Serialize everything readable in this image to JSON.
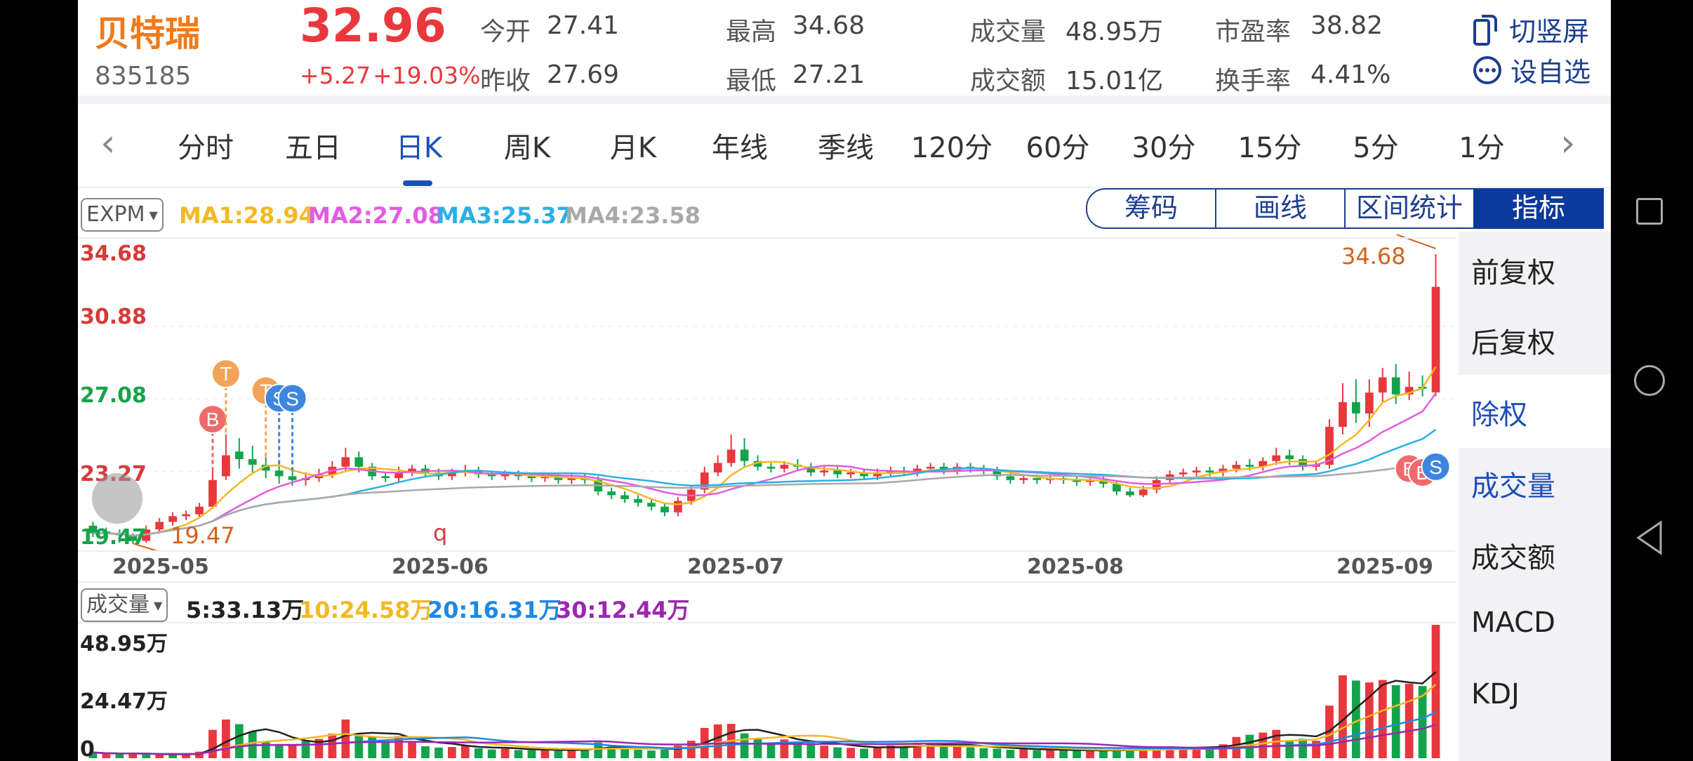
{
  "stock": {
    "name": "贝特瑞",
    "code": "835185",
    "price": "32.96",
    "change": "+5.27",
    "change_pct": "+19.03%"
  },
  "quote": [
    {
      "label": "今开",
      "value": "27.41"
    },
    {
      "label": "昨收",
      "value": "27.69"
    },
    {
      "label": "最高",
      "value": "34.68"
    },
    {
      "label": "最低",
      "value": "27.21"
    },
    {
      "label": "成交量",
      "value": "48.95万"
    },
    {
      "label": "成交额",
      "value": "15.01亿"
    },
    {
      "label": "市盈率",
      "value": "38.82"
    },
    {
      "label": "换手率",
      "value": "4.41%"
    }
  ],
  "actions": {
    "rotate_label": "切竖屏",
    "watchlist_label": "设自选"
  },
  "period_tabs": [
    "分时",
    "五日",
    "日K",
    "周K",
    "月K",
    "年线",
    "季线",
    "120分",
    "60分",
    "30分",
    "15分",
    "5分",
    "1分"
  ],
  "active_tab": "日K",
  "nav": {
    "prev": "‹",
    "next": "›"
  },
  "indicator_select": "EXPM",
  "ma_legend": [
    {
      "text": "MA1:28.94",
      "color": "#f3b924"
    },
    {
      "text": "MA2:27.08",
      "color": "#e25ce0"
    },
    {
      "text": "MA3:25.37",
      "color": "#2ab0e6"
    },
    {
      "text": "MA4:23.58",
      "color": "#a9a9a9"
    }
  ],
  "tool_buttons": [
    "筹码",
    "画线",
    "区间统计",
    "指标"
  ],
  "side_menu": [
    "前复权",
    "后复权",
    "除权",
    "成交量",
    "成交额",
    "MACD",
    "KDJ"
  ],
  "price_axis": {
    "labels": [
      "34.68",
      "30.88",
      "27.08",
      "23.27",
      "19.47"
    ],
    "label_colors": [
      "#d83a3a",
      "#d83a3a",
      "#17a34a",
      "#d83a3a",
      "#17a34a"
    ],
    "max_marker": "34.68",
    "min_marker": "19.47",
    "misc_marker": "q"
  },
  "date_axis": [
    "2025-05",
    "2025-06",
    "2025-07",
    "2025-08",
    "2025-09"
  ],
  "trade_markers": [
    {
      "text": "B",
      "color": "#ee6b6b"
    },
    {
      "text": "T",
      "color": "#f2a35a"
    },
    {
      "text": "T",
      "color": "#f2a35a"
    },
    {
      "text": "S",
      "color": "#3d86e0"
    },
    {
      "text": "S",
      "color": "#3d86e0"
    },
    {
      "text": "B",
      "color": "#ee6b6b"
    },
    {
      "text": "B",
      "color": "#ee6b6b"
    },
    {
      "text": "S",
      "color": "#3d86e0"
    }
  ],
  "volume": {
    "select": "成交量",
    "legend": [
      {
        "text": "5:33.13万",
        "color": "#222222"
      },
      {
        "text": "10:24.58万",
        "color": "#f3b924"
      },
      {
        "text": "20:16.31万",
        "color": "#1e88e5"
      },
      {
        "text": "30:12.44万",
        "color": "#9c27b0"
      }
    ],
    "axis_labels": [
      "48.95万",
      "24.47万",
      "0"
    ]
  },
  "colors": {
    "up": "#e8383d",
    "down": "#13a44b",
    "accent": "#0b3a9c",
    "name": "#f07a18"
  },
  "chart_data": {
    "type": "candlestick",
    "y_range": [
      19.47,
      34.68
    ],
    "volume_range": [
      0,
      48.95
    ],
    "candles": [
      {
        "o": 20.4,
        "c": 20.0,
        "h": 20.6,
        "l": 19.8
      },
      {
        "o": 20.1,
        "c": 20.0,
        "h": 20.3,
        "l": 19.7
      },
      {
        "o": 20.0,
        "c": 19.9,
        "h": 20.2,
        "l": 19.5
      },
      {
        "o": 19.9,
        "c": 19.6,
        "h": 20.0,
        "l": 19.47
      },
      {
        "o": 19.6,
        "c": 20.2,
        "h": 20.4,
        "l": 19.5
      },
      {
        "o": 20.2,
        "c": 20.6,
        "h": 20.8,
        "l": 20.0
      },
      {
        "o": 20.6,
        "c": 20.9,
        "h": 21.1,
        "l": 20.4
      },
      {
        "o": 20.9,
        "c": 21.0,
        "h": 21.2,
        "l": 20.7
      },
      {
        "o": 21.0,
        "c": 21.4,
        "h": 21.6,
        "l": 20.8
      },
      {
        "o": 21.4,
        "c": 22.8,
        "h": 23.4,
        "l": 21.3
      },
      {
        "o": 23.0,
        "c": 24.1,
        "h": 25.2,
        "l": 22.8
      },
      {
        "o": 24.3,
        "c": 23.9,
        "h": 25.0,
        "l": 23.4
      },
      {
        "o": 23.9,
        "c": 23.6,
        "h": 24.6,
        "l": 23.1
      },
      {
        "o": 23.6,
        "c": 23.3,
        "h": 24.0,
        "l": 22.9
      },
      {
        "o": 23.3,
        "c": 23.0,
        "h": 23.6,
        "l": 22.6
      },
      {
        "o": 23.0,
        "c": 22.8,
        "h": 23.3,
        "l": 22.5
      },
      {
        "o": 22.8,
        "c": 22.9,
        "h": 23.2,
        "l": 22.5
      },
      {
        "o": 22.9,
        "c": 23.1,
        "h": 23.4,
        "l": 22.7
      },
      {
        "o": 23.1,
        "c": 23.5,
        "h": 23.8,
        "l": 22.9
      },
      {
        "o": 23.5,
        "c": 24.0,
        "h": 24.5,
        "l": 23.3
      },
      {
        "o": 24.0,
        "c": 23.5,
        "h": 24.3,
        "l": 23.2
      },
      {
        "o": 23.5,
        "c": 23.0,
        "h": 23.7,
        "l": 22.8
      },
      {
        "o": 23.0,
        "c": 22.9,
        "h": 23.2,
        "l": 22.7
      },
      {
        "o": 22.9,
        "c": 23.2,
        "h": 23.5,
        "l": 22.7
      },
      {
        "o": 23.2,
        "c": 23.4,
        "h": 23.6,
        "l": 23.0
      },
      {
        "o": 23.4,
        "c": 23.2,
        "h": 23.6,
        "l": 23.0
      },
      {
        "o": 23.2,
        "c": 23.0,
        "h": 23.4,
        "l": 22.8
      },
      {
        "o": 23.0,
        "c": 23.2,
        "h": 23.4,
        "l": 22.8
      },
      {
        "o": 23.2,
        "c": 23.3,
        "h": 23.6,
        "l": 23.0
      },
      {
        "o": 23.3,
        "c": 23.1,
        "h": 23.5,
        "l": 22.9
      },
      {
        "o": 23.1,
        "c": 23.0,
        "h": 23.3,
        "l": 22.8
      },
      {
        "o": 23.0,
        "c": 23.1,
        "h": 23.3,
        "l": 22.8
      },
      {
        "o": 23.1,
        "c": 23.0,
        "h": 23.3,
        "l": 22.8
      },
      {
        "o": 23.0,
        "c": 22.9,
        "h": 23.2,
        "l": 22.7
      },
      {
        "o": 22.9,
        "c": 23.0,
        "h": 23.2,
        "l": 22.7
      },
      {
        "o": 23.0,
        "c": 22.8,
        "h": 23.2,
        "l": 22.6
      },
      {
        "o": 22.8,
        "c": 22.9,
        "h": 23.1,
        "l": 22.6
      },
      {
        "o": 22.9,
        "c": 22.8,
        "h": 23.1,
        "l": 22.6
      },
      {
        "o": 22.8,
        "c": 22.2,
        "h": 23.0,
        "l": 22.0
      },
      {
        "o": 22.2,
        "c": 22.0,
        "h": 22.4,
        "l": 21.8
      },
      {
        "o": 22.0,
        "c": 21.8,
        "h": 22.2,
        "l": 21.6
      },
      {
        "o": 21.8,
        "c": 21.6,
        "h": 22.0,
        "l": 21.4
      },
      {
        "o": 21.6,
        "c": 21.4,
        "h": 21.8,
        "l": 21.2
      },
      {
        "o": 21.4,
        "c": 21.1,
        "h": 21.6,
        "l": 20.9
      },
      {
        "o": 21.1,
        "c": 21.7,
        "h": 21.9,
        "l": 20.9
      },
      {
        "o": 21.7,
        "c": 22.3,
        "h": 22.5,
        "l": 21.5
      },
      {
        "o": 22.3,
        "c": 23.2,
        "h": 23.5,
        "l": 22.1
      },
      {
        "o": 23.2,
        "c": 23.7,
        "h": 24.1,
        "l": 23.0
      },
      {
        "o": 23.7,
        "c": 24.4,
        "h": 25.2,
        "l": 23.5
      },
      {
        "o": 24.4,
        "c": 23.8,
        "h": 25.0,
        "l": 23.5
      },
      {
        "o": 23.8,
        "c": 23.5,
        "h": 24.1,
        "l": 23.3
      },
      {
        "o": 23.5,
        "c": 23.4,
        "h": 23.7,
        "l": 23.2
      },
      {
        "o": 23.4,
        "c": 23.6,
        "h": 23.8,
        "l": 23.2
      },
      {
        "o": 23.6,
        "c": 23.5,
        "h": 23.9,
        "l": 23.3
      },
      {
        "o": 23.5,
        "c": 23.2,
        "h": 23.7,
        "l": 23.0
      },
      {
        "o": 23.2,
        "c": 23.3,
        "h": 23.5,
        "l": 23.0
      },
      {
        "o": 23.3,
        "c": 23.1,
        "h": 23.5,
        "l": 22.9
      },
      {
        "o": 23.1,
        "c": 23.2,
        "h": 23.4,
        "l": 22.9
      },
      {
        "o": 23.2,
        "c": 23.0,
        "h": 23.4,
        "l": 22.8
      },
      {
        "o": 23.0,
        "c": 23.2,
        "h": 23.4,
        "l": 22.8
      },
      {
        "o": 23.2,
        "c": 23.3,
        "h": 23.5,
        "l": 23.0
      },
      {
        "o": 23.3,
        "c": 23.2,
        "h": 23.5,
        "l": 23.0
      },
      {
        "o": 23.2,
        "c": 23.4,
        "h": 23.6,
        "l": 23.0
      },
      {
        "o": 23.4,
        "c": 23.5,
        "h": 23.7,
        "l": 23.2
      },
      {
        "o": 23.5,
        "c": 23.3,
        "h": 23.7,
        "l": 23.1
      },
      {
        "o": 23.3,
        "c": 23.5,
        "h": 23.7,
        "l": 23.1
      },
      {
        "o": 23.5,
        "c": 23.4,
        "h": 23.7,
        "l": 23.2
      },
      {
        "o": 23.4,
        "c": 23.3,
        "h": 23.6,
        "l": 23.1
      },
      {
        "o": 23.3,
        "c": 23.0,
        "h": 23.5,
        "l": 22.8
      },
      {
        "o": 23.0,
        "c": 22.8,
        "h": 23.2,
        "l": 22.6
      },
      {
        "o": 22.8,
        "c": 22.9,
        "h": 23.1,
        "l": 22.6
      },
      {
        "o": 22.9,
        "c": 22.8,
        "h": 23.1,
        "l": 22.6
      },
      {
        "o": 22.8,
        "c": 22.9,
        "h": 23.1,
        "l": 22.6
      },
      {
        "o": 22.9,
        "c": 22.8,
        "h": 23.1,
        "l": 22.6
      },
      {
        "o": 22.8,
        "c": 22.7,
        "h": 23.0,
        "l": 22.5
      },
      {
        "o": 22.7,
        "c": 22.8,
        "h": 23.0,
        "l": 22.5
      },
      {
        "o": 22.8,
        "c": 22.6,
        "h": 23.0,
        "l": 22.4
      },
      {
        "o": 22.6,
        "c": 22.2,
        "h": 22.8,
        "l": 22.0
      },
      {
        "o": 22.2,
        "c": 22.0,
        "h": 22.4,
        "l": 21.9
      },
      {
        "o": 22.0,
        "c": 22.3,
        "h": 22.5,
        "l": 21.9
      },
      {
        "o": 22.3,
        "c": 22.8,
        "h": 23.0,
        "l": 22.1
      },
      {
        "o": 22.8,
        "c": 23.1,
        "h": 23.3,
        "l": 22.6
      },
      {
        "o": 23.1,
        "c": 23.2,
        "h": 23.4,
        "l": 22.9
      },
      {
        "o": 23.2,
        "c": 23.3,
        "h": 23.5,
        "l": 23.0
      },
      {
        "o": 23.3,
        "c": 23.2,
        "h": 23.5,
        "l": 23.0
      },
      {
        "o": 23.2,
        "c": 23.4,
        "h": 23.6,
        "l": 23.0
      },
      {
        "o": 23.4,
        "c": 23.6,
        "h": 23.8,
        "l": 23.2
      },
      {
        "o": 23.6,
        "c": 23.5,
        "h": 23.9,
        "l": 23.3
      },
      {
        "o": 23.5,
        "c": 23.8,
        "h": 24.0,
        "l": 23.3
      },
      {
        "o": 23.8,
        "c": 24.1,
        "h": 24.5,
        "l": 23.6
      },
      {
        "o": 24.1,
        "c": 23.9,
        "h": 24.4,
        "l": 23.6
      },
      {
        "o": 23.9,
        "c": 23.5,
        "h": 24.1,
        "l": 23.3
      },
      {
        "o": 23.5,
        "c": 23.6,
        "h": 23.8,
        "l": 23.3
      },
      {
        "o": 23.6,
        "c": 25.6,
        "h": 26.0,
        "l": 23.4
      },
      {
        "o": 25.6,
        "c": 26.9,
        "h": 27.9,
        "l": 25.2
      },
      {
        "o": 26.9,
        "c": 26.3,
        "h": 28.1,
        "l": 25.8
      },
      {
        "o": 26.3,
        "c": 27.4,
        "h": 28.1,
        "l": 25.6
      },
      {
        "o": 27.4,
        "c": 28.2,
        "h": 28.7,
        "l": 26.9
      },
      {
        "o": 28.2,
        "c": 27.3,
        "h": 28.9,
        "l": 26.8
      },
      {
        "o": 27.3,
        "c": 27.7,
        "h": 28.5,
        "l": 27.0
      },
      {
        "o": 27.7,
        "c": 27.6,
        "h": 28.3,
        "l": 27.2
      },
      {
        "o": 27.41,
        "c": 32.96,
        "h": 34.68,
        "l": 27.21
      }
    ],
    "volumes": [
      {
        "v": 2.1,
        "up": 0
      },
      {
        "v": 1.6,
        "up": 1
      },
      {
        "v": 1.5,
        "up": 0
      },
      {
        "v": 1.7,
        "up": 1
      },
      {
        "v": 1.4,
        "up": 0
      },
      {
        "v": 1.2,
        "up": 1
      },
      {
        "v": 1.3,
        "up": 0
      },
      {
        "v": 1.5,
        "up": 1
      },
      {
        "v": 2.4,
        "up": 1
      },
      {
        "v": 10.4,
        "up": 1
      },
      {
        "v": 14.2,
        "up": 1
      },
      {
        "v": 12.5,
        "up": 0
      },
      {
        "v": 9.8,
        "up": 0
      },
      {
        "v": 6.2,
        "up": 0
      },
      {
        "v": 5.1,
        "up": 0
      },
      {
        "v": 4.8,
        "up": 1
      },
      {
        "v": 6.3,
        "up": 0
      },
      {
        "v": 7.1,
        "up": 1
      },
      {
        "v": 9.0,
        "up": 1
      },
      {
        "v": 14.2,
        "up": 1
      },
      {
        "v": 8.5,
        "up": 0
      },
      {
        "v": 7.8,
        "up": 0
      },
      {
        "v": 6.0,
        "up": 0
      },
      {
        "v": 8.1,
        "up": 1
      },
      {
        "v": 6.2,
        "up": 1
      },
      {
        "v": 4.4,
        "up": 0
      },
      {
        "v": 3.9,
        "up": 0
      },
      {
        "v": 4.1,
        "up": 1
      },
      {
        "v": 4.8,
        "up": 1
      },
      {
        "v": 3.6,
        "up": 0
      },
      {
        "v": 3.2,
        "up": 0
      },
      {
        "v": 3.5,
        "up": 1
      },
      {
        "v": 3.0,
        "up": 0
      },
      {
        "v": 2.9,
        "up": 0
      },
      {
        "v": 3.1,
        "up": 1
      },
      {
        "v": 2.8,
        "up": 0
      },
      {
        "v": 3.4,
        "up": 1
      },
      {
        "v": 3.0,
        "up": 0
      },
      {
        "v": 5.8,
        "up": 0
      },
      {
        "v": 4.3,
        "up": 0
      },
      {
        "v": 3.6,
        "up": 0
      },
      {
        "v": 3.1,
        "up": 0
      },
      {
        "v": 2.8,
        "up": 0
      },
      {
        "v": 3.2,
        "up": 0
      },
      {
        "v": 4.6,
        "up": 1
      },
      {
        "v": 6.4,
        "up": 1
      },
      {
        "v": 11.1,
        "up": 1
      },
      {
        "v": 12.4,
        "up": 1
      },
      {
        "v": 12.6,
        "up": 1
      },
      {
        "v": 9.1,
        "up": 0
      },
      {
        "v": 7.0,
        "up": 0
      },
      {
        "v": 5.8,
        "up": 0
      },
      {
        "v": 6.9,
        "up": 1
      },
      {
        "v": 6.0,
        "up": 0
      },
      {
        "v": 5.6,
        "up": 0
      },
      {
        "v": 4.6,
        "up": 1
      },
      {
        "v": 4.0,
        "up": 0
      },
      {
        "v": 3.8,
        "up": 1
      },
      {
        "v": 3.5,
        "up": 0
      },
      {
        "v": 4.0,
        "up": 1
      },
      {
        "v": 4.8,
        "up": 1
      },
      {
        "v": 3.9,
        "up": 0
      },
      {
        "v": 5.7,
        "up": 1
      },
      {
        "v": 5.2,
        "up": 1
      },
      {
        "v": 4.5,
        "up": 0
      },
      {
        "v": 4.9,
        "up": 1
      },
      {
        "v": 4.0,
        "up": 0
      },
      {
        "v": 3.7,
        "up": 0
      },
      {
        "v": 3.5,
        "up": 0
      },
      {
        "v": 3.1,
        "up": 0
      },
      {
        "v": 3.4,
        "up": 1
      },
      {
        "v": 2.9,
        "up": 0
      },
      {
        "v": 3.2,
        "up": 1
      },
      {
        "v": 2.8,
        "up": 0
      },
      {
        "v": 2.7,
        "up": 0
      },
      {
        "v": 2.9,
        "up": 1
      },
      {
        "v": 2.6,
        "up": 0
      },
      {
        "v": 3.5,
        "up": 0
      },
      {
        "v": 2.8,
        "up": 0
      },
      {
        "v": 3.3,
        "up": 1
      },
      {
        "v": 4.2,
        "up": 1
      },
      {
        "v": 4.4,
        "up": 1
      },
      {
        "v": 3.9,
        "up": 1
      },
      {
        "v": 3.6,
        "up": 1
      },
      {
        "v": 3.9,
        "up": 0
      },
      {
        "v": 5.1,
        "up": 1
      },
      {
        "v": 7.8,
        "up": 1
      },
      {
        "v": 8.6,
        "up": 0
      },
      {
        "v": 9.4,
        "up": 1
      },
      {
        "v": 10.4,
        "up": 1
      },
      {
        "v": 6.6,
        "up": 0
      },
      {
        "v": 7.1,
        "up": 0
      },
      {
        "v": 6.4,
        "up": 1
      },
      {
        "v": 19.3,
        "up": 1
      },
      {
        "v": 30.4,
        "up": 1
      },
      {
        "v": 28.5,
        "up": 0
      },
      {
        "v": 27.8,
        "up": 1
      },
      {
        "v": 28.7,
        "up": 1
      },
      {
        "v": 26.8,
        "up": 0
      },
      {
        "v": 27.3,
        "up": 1
      },
      {
        "v": 26.5,
        "up": 0
      },
      {
        "v": 48.95,
        "up": 1
      }
    ]
  }
}
